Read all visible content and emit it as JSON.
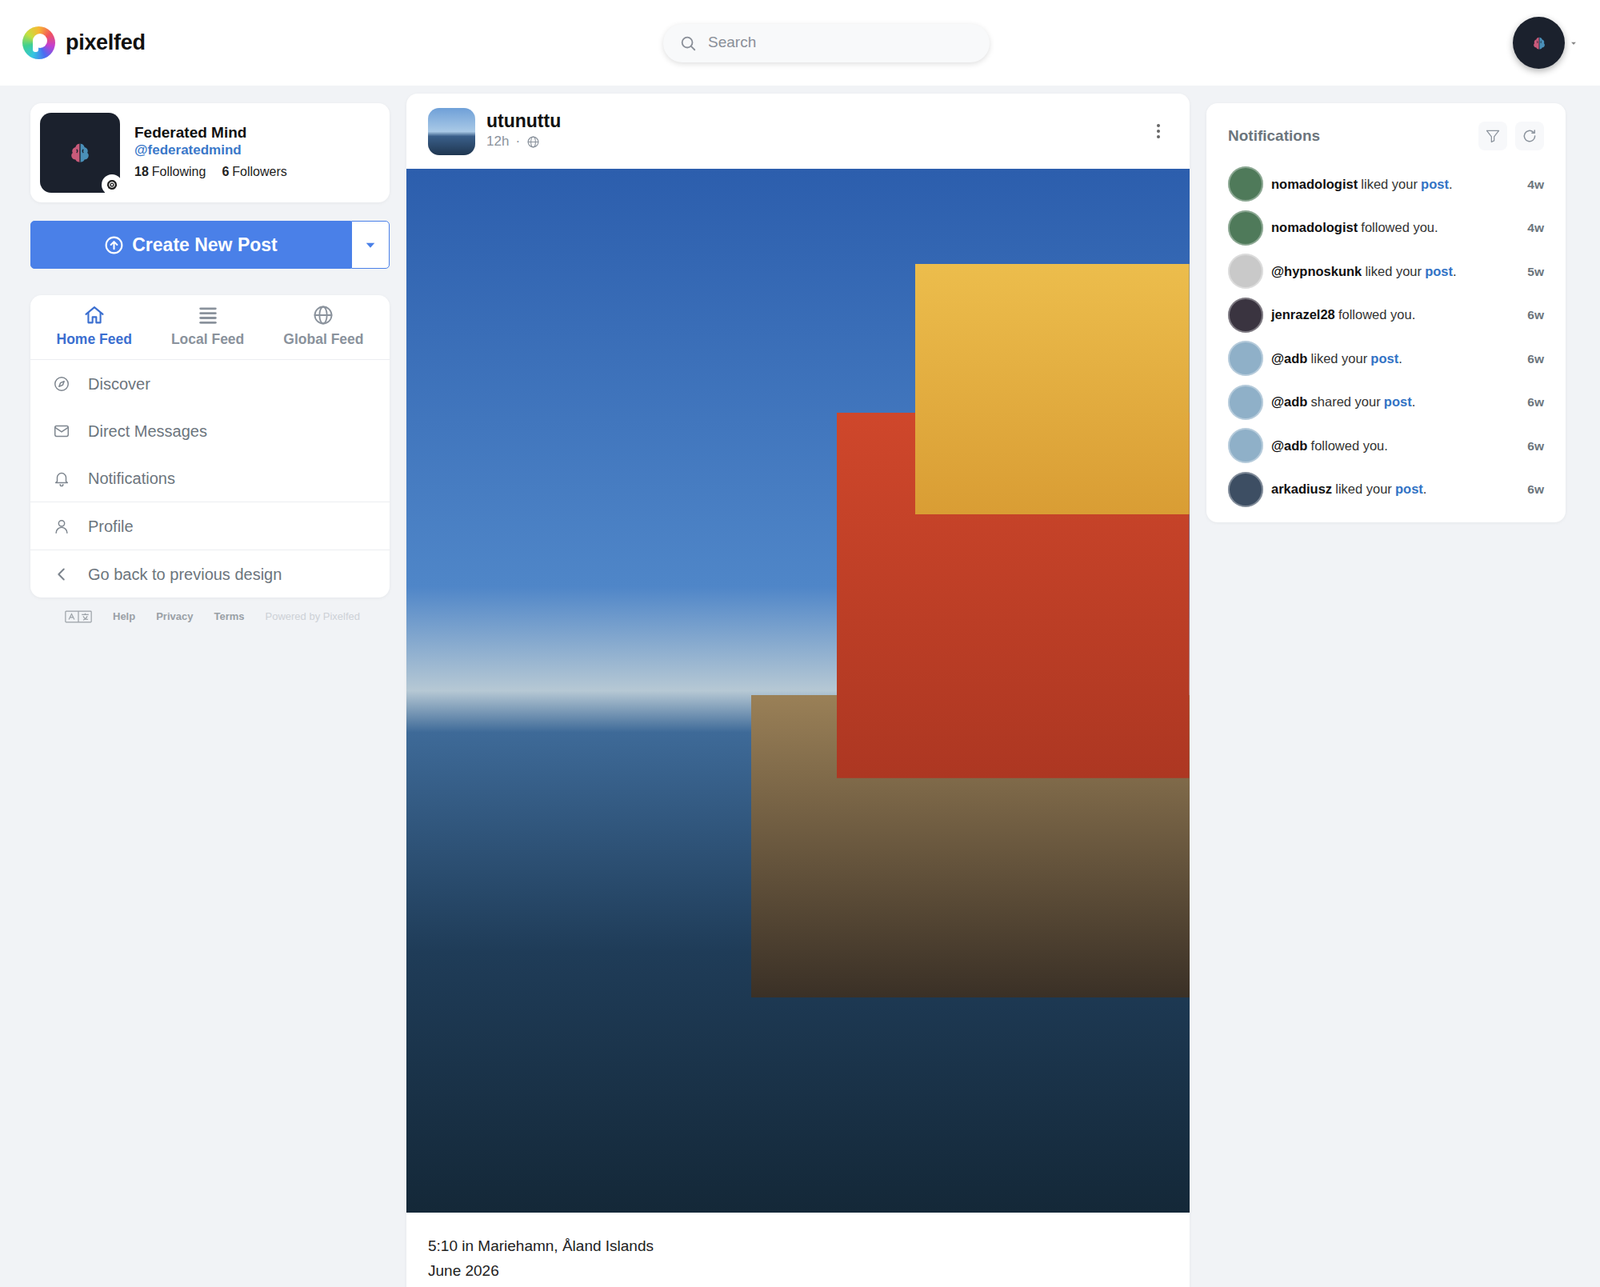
{
  "app": {
    "logo": "pixelfed"
  },
  "search": {
    "placeholder": "Search"
  },
  "profile": {
    "name": "Federated Mind",
    "handle": "@federatedmind",
    "following_count": "18",
    "following_label": "Following",
    "followers_count": "6",
    "followers_label": "Followers"
  },
  "create_button": {
    "label": "Create New Post"
  },
  "feed_tabs": [
    {
      "label": "Home Feed",
      "selected": true
    },
    {
      "label": "Local Feed",
      "selected": false
    },
    {
      "label": "Global Feed",
      "selected": false
    }
  ],
  "menu_groups": [
    [
      {
        "label": "Discover"
      },
      {
        "label": "Direct Messages"
      },
      {
        "label": "Notifications"
      }
    ],
    [
      {
        "label": "Profile"
      }
    ],
    [
      {
        "label": "Go back to previous design"
      }
    ]
  ],
  "footer": [
    "Help",
    "Privacy",
    "Terms",
    "Powered by Pixelfed"
  ],
  "post": {
    "author": "utunuttu",
    "time": "12h",
    "separator": "·",
    "caption": [
      "5:10 in Mariehamn, Åland Islands",
      "June 2026"
    ]
  },
  "notifications": {
    "title": "Notifications",
    "items": [
      {
        "user": "nomadologist",
        "text": "liked your",
        "link": "post",
        "end": ".",
        "time": "4w",
        "color": "#4f7a5a"
      },
      {
        "user": "nomadologist",
        "text": "followed you.",
        "time": "4w",
        "color": "#4f7a5a"
      },
      {
        "user": "@hypnoskunk",
        "text": "liked your",
        "link": "post",
        "end": ".",
        "time": "5w",
        "color": "#c9c9c9"
      },
      {
        "user": "jenrazel28",
        "text": "followed you.",
        "time": "6w",
        "color": "#3a3440"
      },
      {
        "user": "@adb",
        "text": "liked your",
        "link": "post",
        "end": ".",
        "time": "6w",
        "color": "#8fb0c8"
      },
      {
        "user": "@adb",
        "text": "shared your",
        "link": "post",
        "end": ".",
        "time": "6w",
        "color": "#8fb0c8"
      },
      {
        "user": "@adb",
        "text": "followed you.",
        "time": "6w",
        "color": "#8fb0c8"
      },
      {
        "user": "arkadiusz",
        "text": "liked your",
        "link": "post",
        "end": ".",
        "time": "6w",
        "color": "#3d4e63"
      }
    ]
  }
}
